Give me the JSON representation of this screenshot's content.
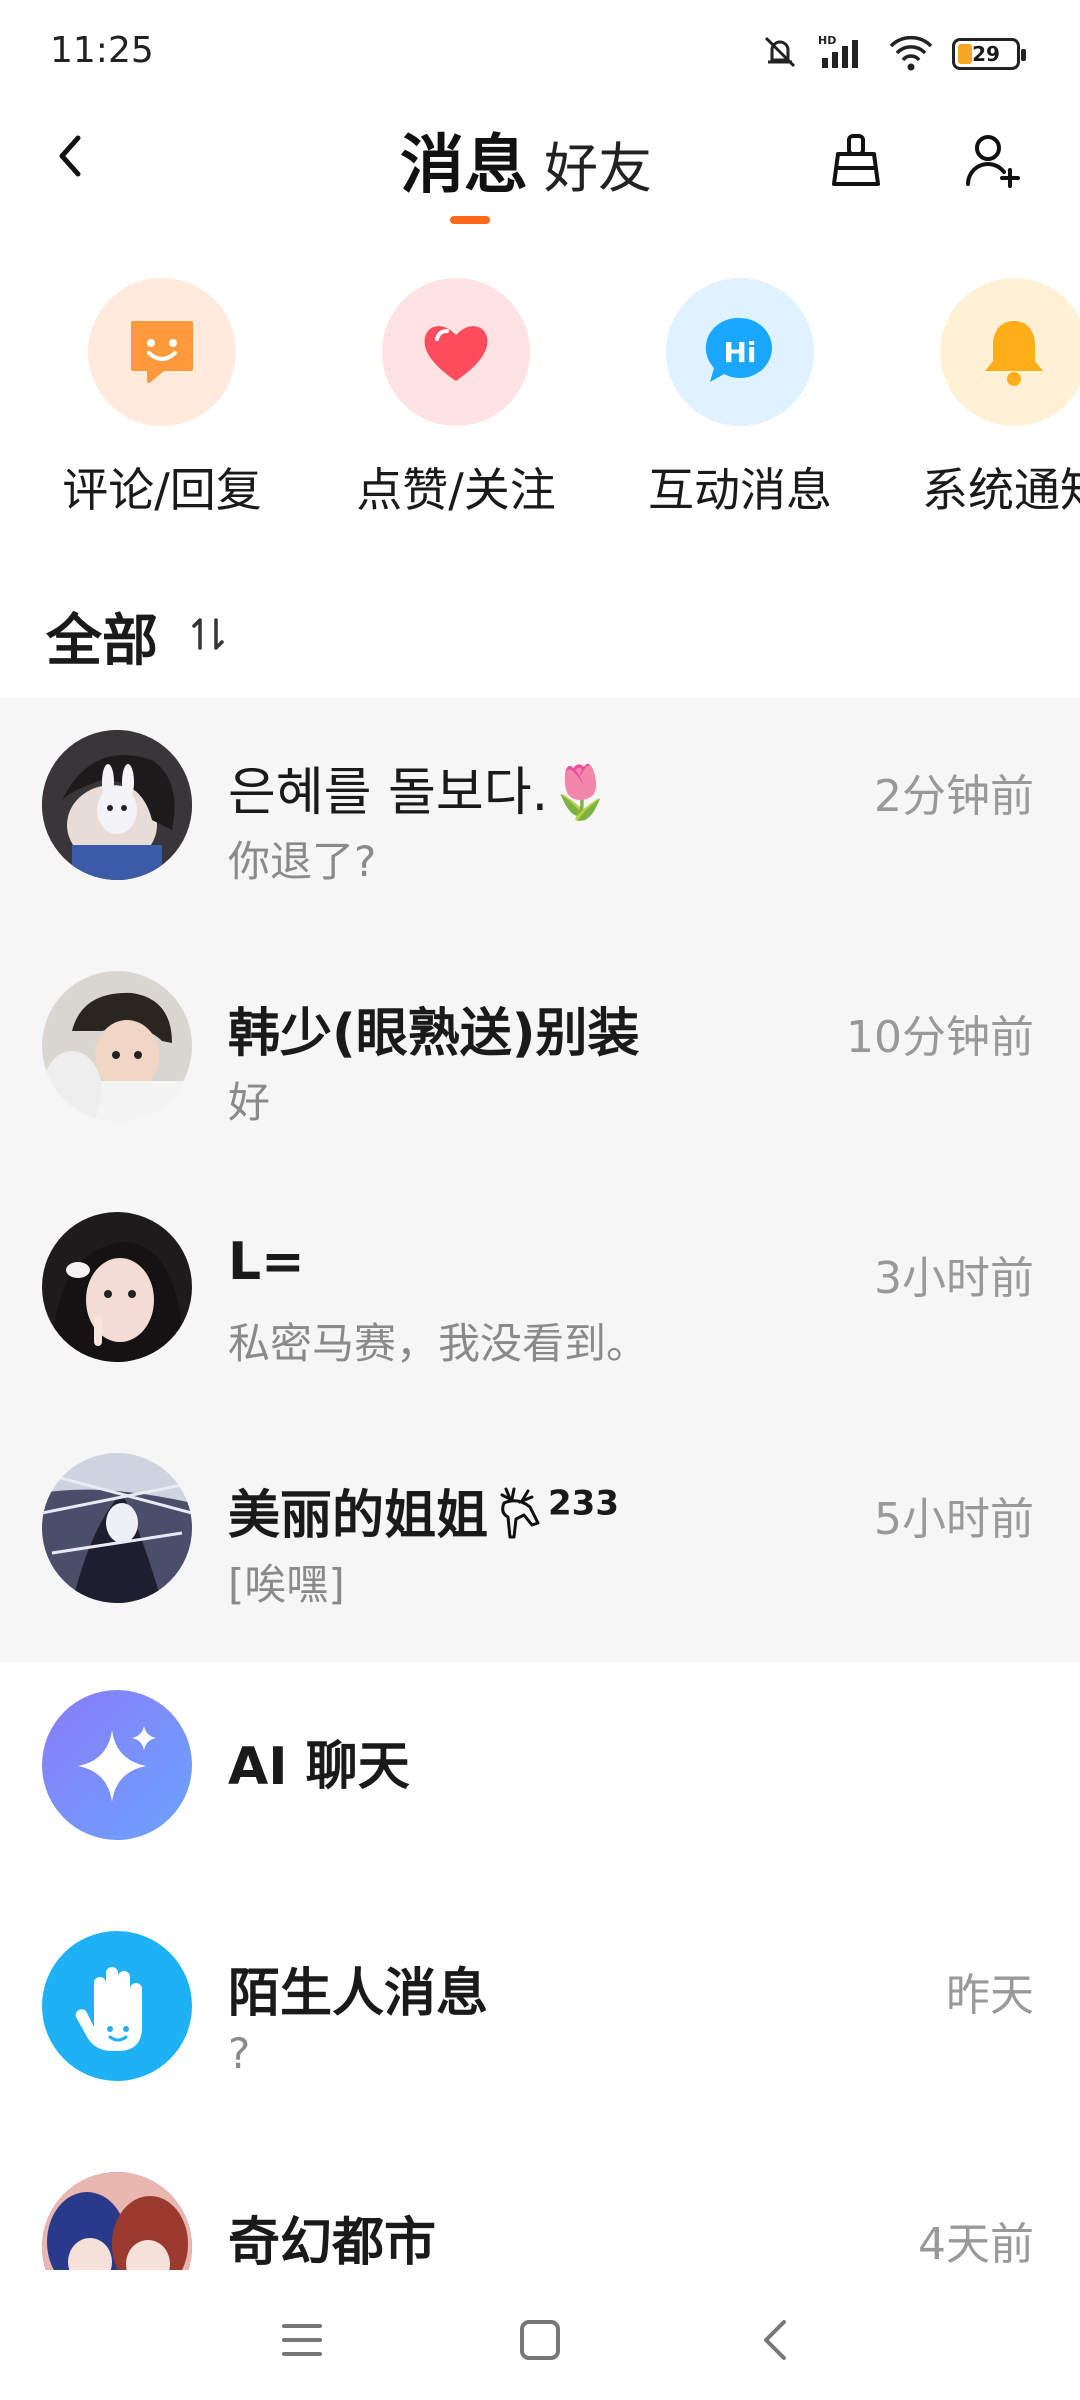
{
  "status_bar": {
    "time": "11:25",
    "icons": [
      "mute-icon",
      "hd-signal-icon",
      "wifi-icon"
    ],
    "battery": "29"
  },
  "header": {
    "tab_messages": "消息",
    "tab_friends": "好友",
    "accent_color": "#ff6a1a",
    "icons": [
      "back-icon",
      "broom-icon",
      "add-friend-icon"
    ]
  },
  "quick_entries": [
    {
      "label": "评论/回复",
      "icon": "comment-smile-icon",
      "bg": "#ffeadb",
      "fg": "#ff9a3c"
    },
    {
      "label": "点赞/关注",
      "icon": "heart-icon",
      "bg": "#ffe3e3",
      "fg": "#ff4d5e"
    },
    {
      "label": "互动消息",
      "icon": "hi-bubble-icon",
      "bg": "#dff2ff",
      "fg": "#1aa7ff"
    },
    {
      "label": "系统通知",
      "icon": "bell-icon",
      "bg": "#fff0d6",
      "fg": "#ffae1a"
    }
  ],
  "section": {
    "title": "全部",
    "sort_icon": "sort-icon"
  },
  "messages": [
    {
      "name": "은혜를 돌보다.",
      "emoji": "🌷",
      "preview": "你退了?",
      "time": "2分钟前"
    },
    {
      "name": "韩少(眼熟送)别装",
      "preview": "好",
      "time": "10分钟前"
    },
    {
      "name": "L=",
      "preview": "私密马赛，我没看到。",
      "time": "3小时前"
    },
    {
      "name": "美丽的姐姐",
      "badge": "233",
      "preview": "[唉嘿]",
      "time": "5小时前"
    },
    {
      "name": "AI 聊天",
      "preview": "",
      "time": ""
    },
    {
      "name": "陌生人消息",
      "preview": "?",
      "time": "昨天"
    },
    {
      "name": "奇幻都市",
      "preview": "",
      "time": "4天前"
    }
  ],
  "navbar": {
    "icons": [
      "menu-icon",
      "home-icon",
      "back-nav-icon"
    ]
  }
}
